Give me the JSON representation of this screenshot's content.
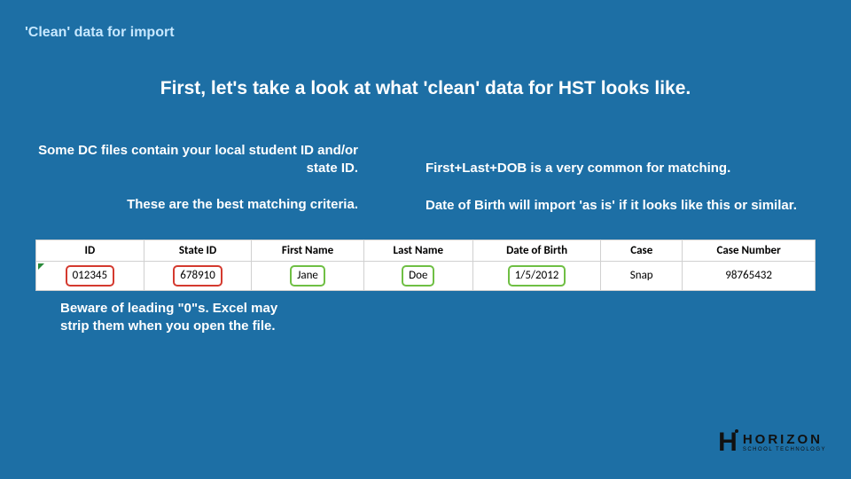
{
  "title": "'Clean' data for import",
  "headline": "First, let's take a look at what 'clean' data for HST looks like.",
  "left": {
    "line1": "Some DC files contain your local student ID and/or state ID.",
    "line2": "These are the best matching criteria."
  },
  "right": {
    "line1": "First+Last+DOB is a very common for matching.",
    "line2": "Date of Birth will import 'as is' if it looks like this or similar."
  },
  "table": {
    "headers": [
      "ID",
      "State ID",
      "First Name",
      "Last Name",
      "Date of Birth",
      "Case",
      "Case Number"
    ],
    "row": {
      "id": "012345",
      "state_id": "678910",
      "first_name": "Jane",
      "last_name": "Doe",
      "dob": "1/5/2012",
      "case": "Snap",
      "case_number": "98765432"
    }
  },
  "warn": "Beware of leading \"0\"s. Excel may strip them when you open the file.",
  "logo": {
    "mark": "H",
    "name": "HORIZON",
    "tag": "SCHOOL TECHNOLOGY"
  }
}
